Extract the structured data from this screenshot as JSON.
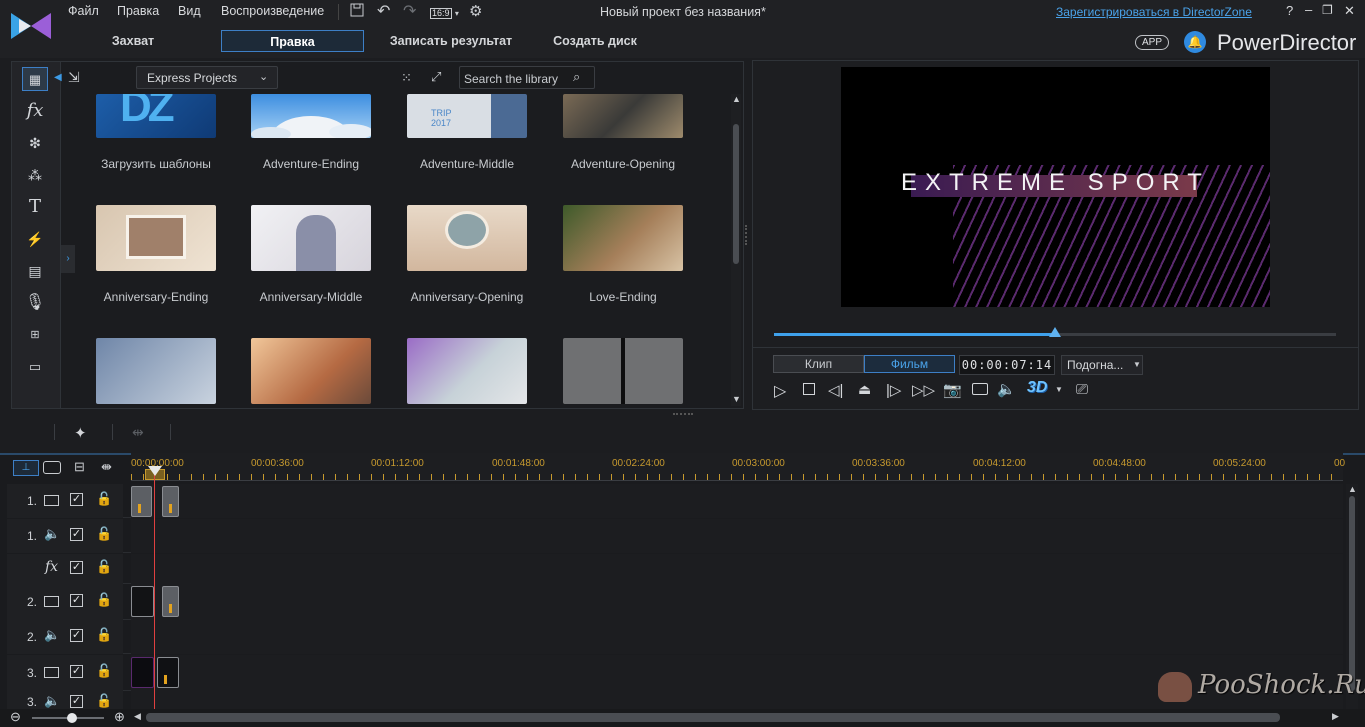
{
  "menu": [
    "Файл",
    "Правка",
    "Вид",
    "Воспроизведение"
  ],
  "aspect_ratio": "16:9",
  "project_title": "Новый проект без названия*",
  "register_link": "Зарегистрироваться в DirectorZone",
  "window_controls": [
    "?",
    "–",
    "❐",
    "✕"
  ],
  "tabs": [
    {
      "label": "Захват",
      "active": false
    },
    {
      "label": "Правка",
      "active": true
    },
    {
      "label": "Записать результат",
      "active": false
    },
    {
      "label": "Создать диск",
      "active": false
    }
  ],
  "brand": {
    "app_badge": "APP",
    "name": "PowerDirector"
  },
  "library": {
    "dropdown": "Express Projects",
    "search_placeholder": "Search the library",
    "items": [
      {
        "label": "Загрузить шаблоны"
      },
      {
        "label": "Adventure-Ending"
      },
      {
        "label": "Adventure-Middle",
        "thumb_text": "TRIP 2017"
      },
      {
        "label": "Adventure-Opening"
      },
      {
        "label": "Anniversary-Ending"
      },
      {
        "label": "Anniversary-Middle"
      },
      {
        "label": "Anniversary-Opening"
      },
      {
        "label": "Love-Ending"
      },
      {
        "label": ""
      },
      {
        "label": ""
      },
      {
        "label": ""
      },
      {
        "label": ""
      }
    ]
  },
  "preview": {
    "overlay_text": "EXTREME SPORT",
    "clip_label": "Клип",
    "movie_label": "Фильм",
    "timecode": "00:00:07:14",
    "fit_label": "Подогна...",
    "badge_3d": "3D",
    "scrub_progress": 0.5
  },
  "timeline": {
    "ruler": [
      "00:00:00:00",
      "00:00:36:00",
      "00:01:12:00",
      "00:01:48:00",
      "00:02:24:00",
      "00:03:00:00",
      "00:03:36:00",
      "00:04:12:00",
      "00:04:48:00",
      "00:05:24:00",
      "00"
    ],
    "tracks": [
      {
        "num": "1.",
        "kind": "video"
      },
      {
        "num": "1.",
        "kind": "audio"
      },
      {
        "num": "",
        "kind": "fx"
      },
      {
        "num": "2.",
        "kind": "video"
      },
      {
        "num": "2.",
        "kind": "audio"
      },
      {
        "num": "3.",
        "kind": "video"
      },
      {
        "num": "3.",
        "kind": "audio"
      }
    ]
  },
  "watermark": "PooShock.Ru",
  "colors": {
    "accent": "#3d7fc6",
    "ruler": "#c79a2e",
    "playhead": "#e04040"
  }
}
